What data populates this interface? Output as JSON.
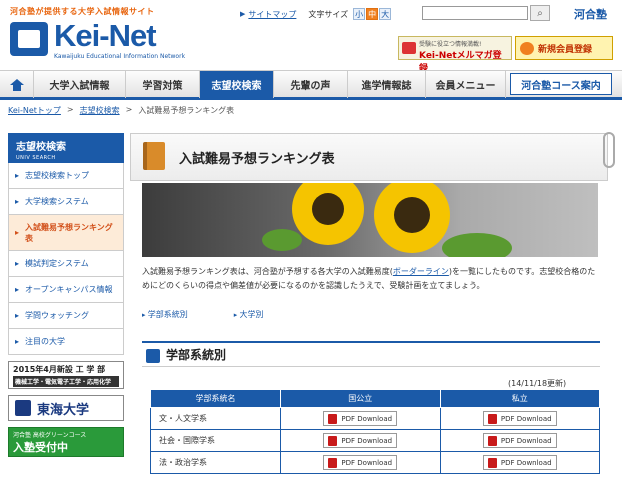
{
  "header": {
    "tagline": "河合塾が提供する大学入試情報サイト",
    "logo_text": "Kei-Net",
    "logo_sub": "Kawaijuku Educational Information Network",
    "sitemap_label": "サイトマップ",
    "font_size_label": "文字サイズ",
    "font_sizes": [
      "小",
      "中",
      "大"
    ],
    "brand": "河合塾",
    "mailmag_sub": "受験に役立つ情報満載!",
    "mailmag_main": "Kei-Netメルマガ登録",
    "register_label": "新規会員登録"
  },
  "nav": {
    "items": [
      "大学入試情報",
      "学習対策",
      "志望校検索",
      "先輩の声",
      "進学情報誌",
      "会員メニュー",
      "河合塾コース案内"
    ]
  },
  "breadcrumb": [
    "Kei-Netトップ",
    "志望校検索",
    "入試難易予想ランキング表"
  ],
  "sidebar": {
    "heading": "志望校検索",
    "heading_sub": "UNIV SEARCH",
    "items": [
      "志望校検索トップ",
      "大学検索システム",
      "入試難易予想ランキング表",
      "模試判定システム",
      "オープンキャンパス情報",
      "学問ウォッチング",
      "注目の大学"
    ],
    "banner1_title": "2015年4月新設 工 学 部",
    "banner1_sub": "機械工学・電気電子工学・応用化学",
    "banner2_title": "東海大学",
    "banner3_sub": "河合塾 高校グリーンコース",
    "banner3_title": "入塾受付中"
  },
  "main": {
    "title": "入試難易予想ランキング表",
    "desc_pre": "入試難易予想ランキング表は、河合塾が予想する各大学の入試難易度(",
    "desc_link": "ボーダーライン",
    "desc_post": ")を一覧にしたものです。志望校合格のためにどのくらいの得点や偏差値が必要になるのかを認識したうえで、受験計画を立てましょう。",
    "jump_links": [
      "学部系統別",
      "大学別"
    ],
    "section_title": "学部系統別",
    "updated": "(14/11/18更新)",
    "table_headers": [
      "学部系統名",
      "国公立",
      "私立"
    ],
    "rows": [
      {
        "name": "文・人文学系",
        "public": "PDF Download",
        "private": "PDF Download"
      },
      {
        "name": "社会・国際学系",
        "public": "PDF Download",
        "private": "PDF Download"
      },
      {
        "name": "法・政治学系",
        "public": "PDF Download",
        "private": "PDF Download"
      }
    ]
  }
}
